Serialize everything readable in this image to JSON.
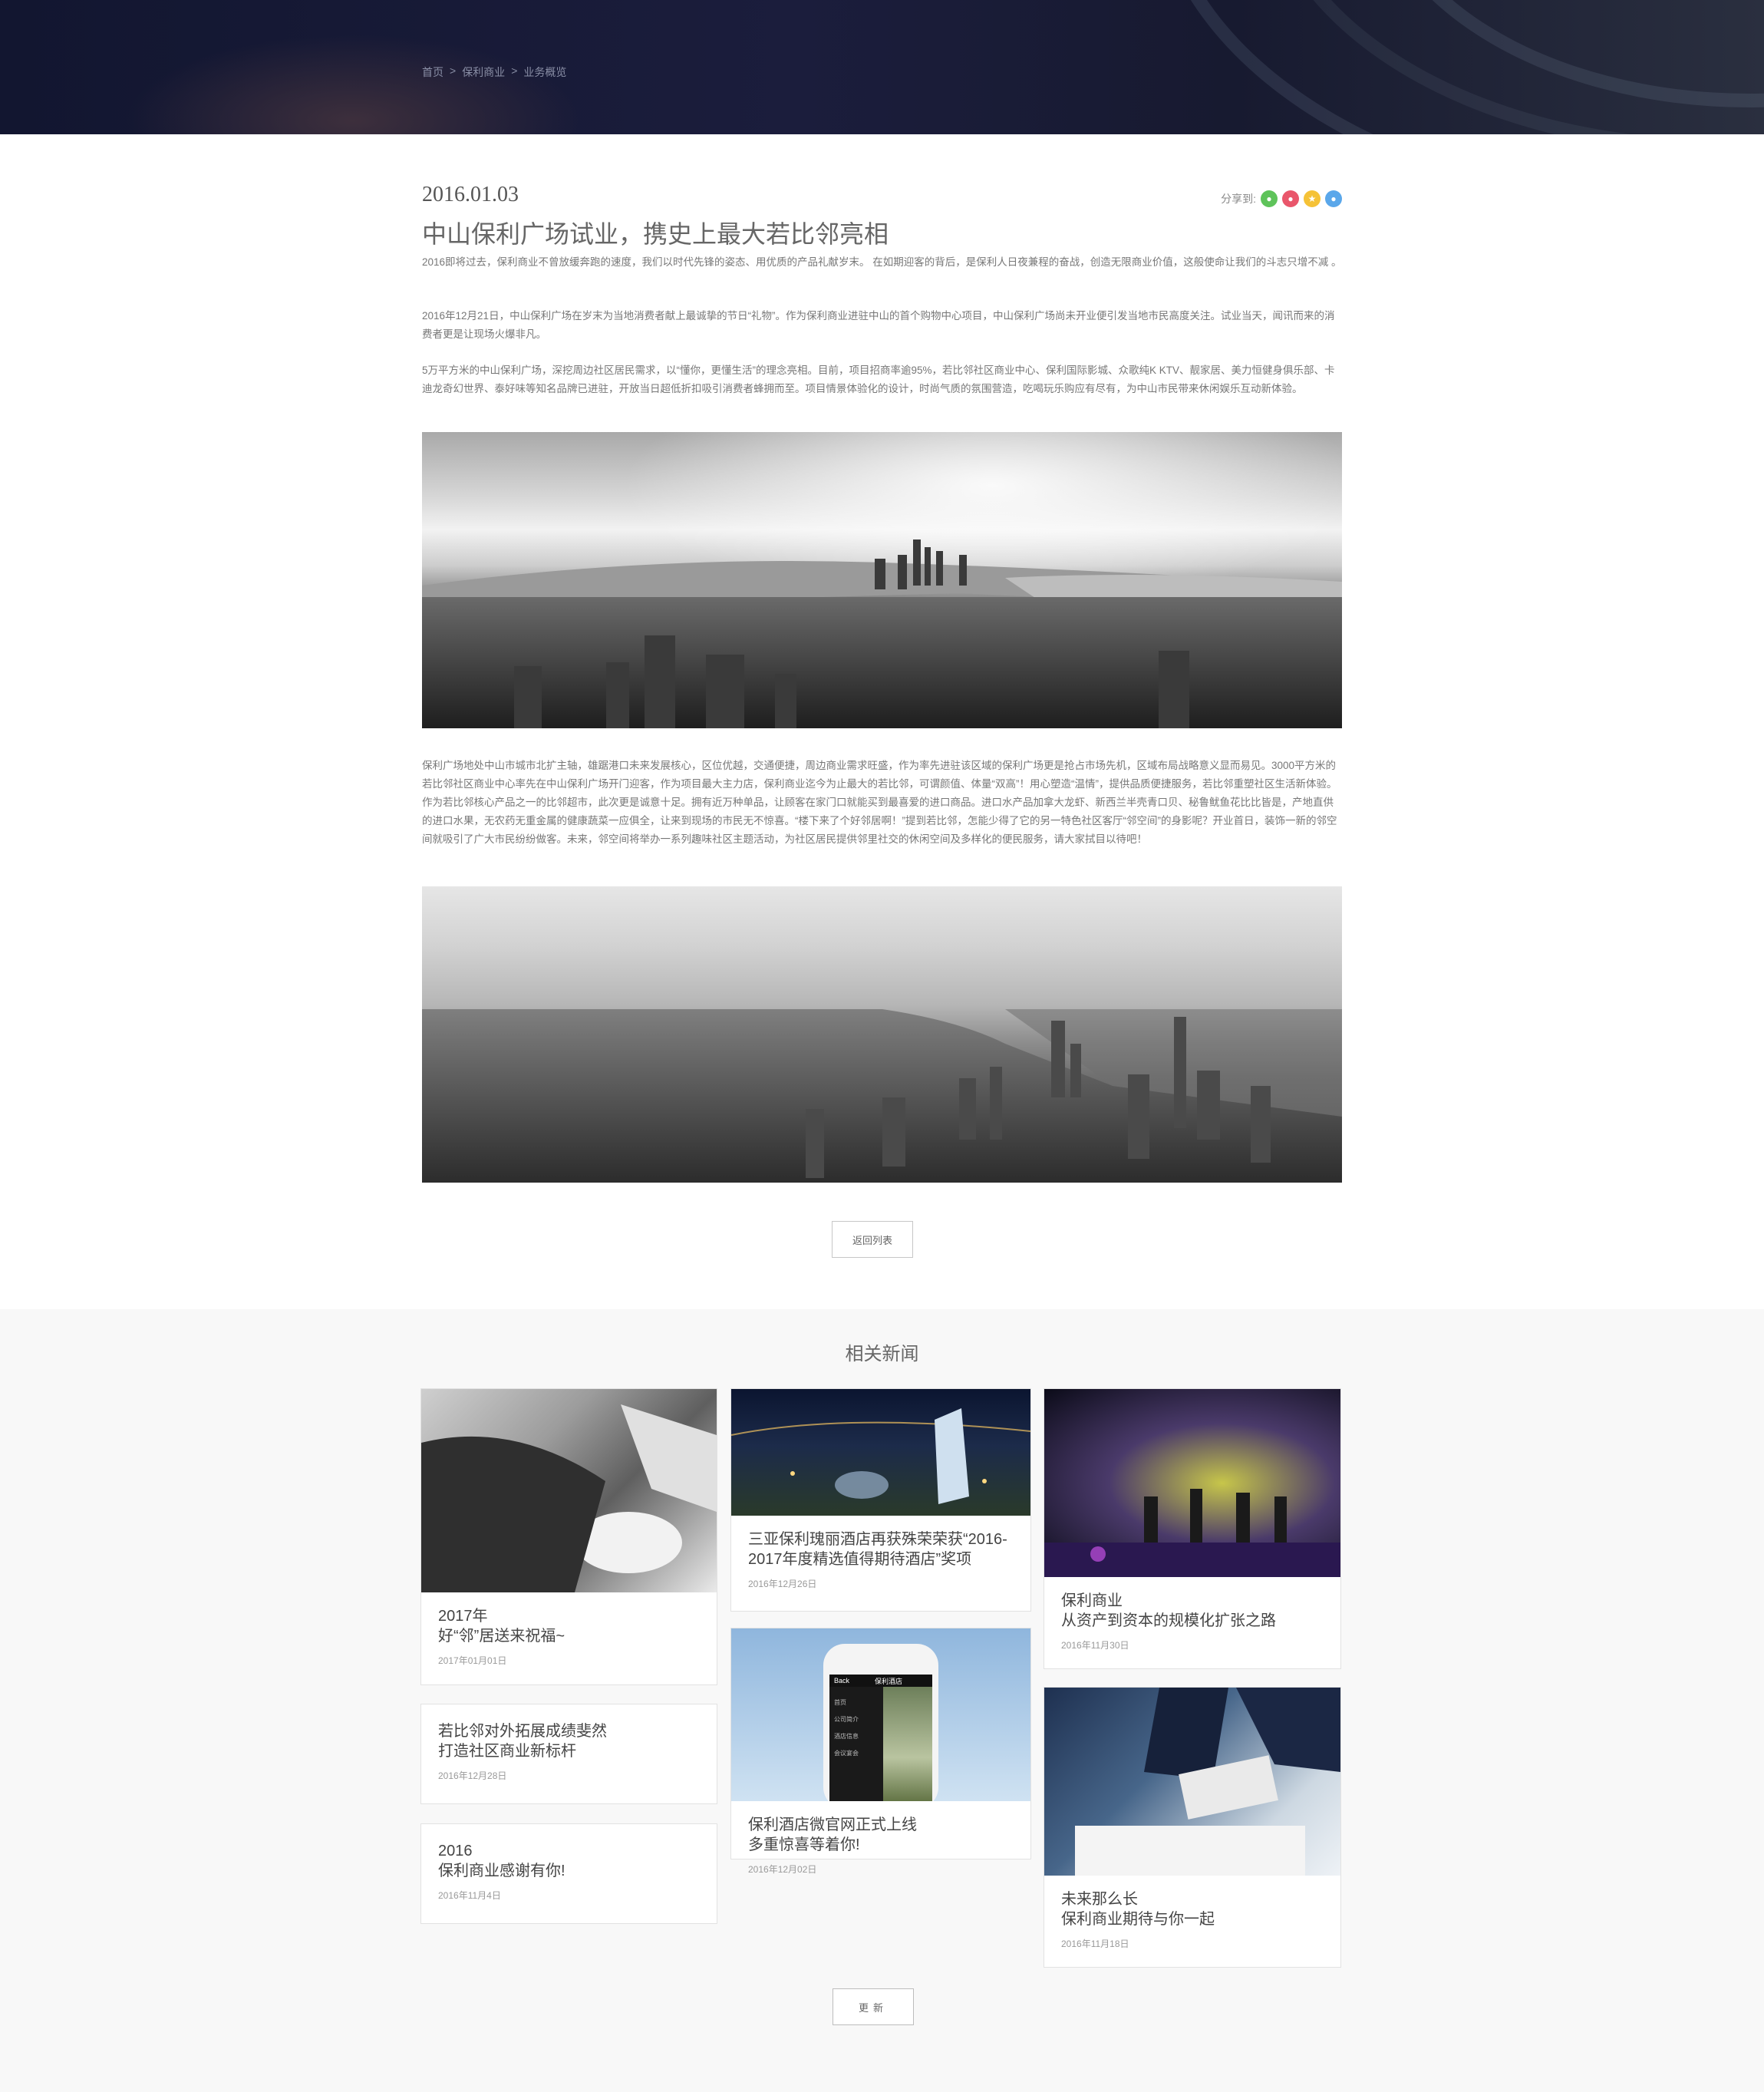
{
  "breadcrumb": {
    "home": "首页",
    "sep1": ">",
    "section": "保利商业",
    "sep2": ">",
    "current": "业务概览"
  },
  "article": {
    "date": "2016.01.03",
    "title": "中山保利广场试业，携史上最大若比邻亮相",
    "share_label": "分享到:",
    "share_icons": [
      "wechat-icon",
      "weibo-icon",
      "qzone-icon",
      "qq-icon"
    ],
    "share_colors": [
      "#5ec35a",
      "#e9566b",
      "#f5c237",
      "#5aa7ea"
    ],
    "paragraph_1": " 2016即将过去，保利商业不曾放缓奔跑的速度，我们以时代先锋的姿态、用优质的产品礼献岁末。 在如期迎客的背后，是保利人日夜兼程的奋战，创造无限商业价值，这般使命让我们的斗志只增不减 。",
    "paragraph_2": "2016年12月21日，中山保利广场在岁末为当地消费者献上最诚挚的节日“礼物”。作为保利商业进驻中山的首个购物中心项目，中山保利广场尚未开业便引发当地市民高度关注。试业当天，闻讯而来的消费者更是让现场火爆非凡。",
    "paragraph_3": "5万平方米的中山保利广场，深挖周边社区居民需求，以“懂你，更懂生活”的理念亮相。目前，项目招商率逾95%，若比邻社区商业中心、保利国际影城、众歌纯K KTV、靓家居、美力恒健身俱乐部、卡迪龙奇幻世界、泰好味等知名品牌已进驻，开放当日超低折扣吸引消费者蜂拥而至。项目情景体验化的设计，时尚气质的氛围营造，吃喝玩乐购应有尽有，为中山市民带来休闲娱乐互动新体验。",
    "paragraph_4": "保利广场地处中山市城市北扩主轴，雄踞港口未来发展核心，区位优越，交通便捷，周边商业需求旺盛，作为率先进驻该区域的保利广场更是抢占市场先机，区域布局战略意义显而易见。3000平方米的若比邻社区商业中心率先在中山保利广场开门迎客，作为项目最大主力店，保利商业迄今为止最大的若比邻，可谓颜值、体量“双高”！用心塑造“温情”，提供品质便捷服务，若比邻重塑社区生活新体验。作为若比邻核心产品之一的比邻超市，此次更是诚意十足。拥有近万种单品，让顾客在家门口就能买到最喜爱的进口商品。进口水产品加拿大龙虾、新西兰半壳青口贝、秘鲁鱿鱼花比比皆是，产地直供的进口水果，无农药无重金属的健康蔬菜一应俱全，让来到现场的市民无不惊喜。“楼下来了个好邻居啊！”提到若比邻，怎能少得了它的另一特色社区客厅“邻空间”的身影呢？开业首日，装饰一新的邻空间就吸引了广大市民纷纷做客。未来，邻空间将举办一系列趣味社区主题活动，为社区居民提供邻里社交的休闲空间及多样化的便民服务，请大家拭目以待吧！",
    "back_label": "返回列表"
  },
  "related": {
    "title": "相关新闻",
    "more_label": "更新",
    "cards": [
      {
        "title_1": "2017年",
        "title_2": "好“邻”居送来祝福~",
        "date": "2017年01月01日"
      },
      {
        "title_1": "若比邻对外拓展成绩斐然",
        "title_2": "打造社区商业新标杆",
        "date": "2016年12月28日"
      },
      {
        "title_1": "2016",
        "title_2": "保利商业感谢有你!",
        "date": "2016年11月4日"
      },
      {
        "title_1": "三亚保利瑰丽酒店再获殊荣荣获“2016-",
        "title_2": "2017年度精选值得期待酒店”奖项",
        "date": "2016年12月26日"
      },
      {
        "title_1": "保利酒店微官网正式上线",
        "title_2": "多重惊喜等着你!",
        "date": "2016年12月02日"
      },
      {
        "title_1": "保利商业",
        "title_2": "从资产到资本的规模化扩张之路",
        "date": "2016年11月30日"
      },
      {
        "title_1": "未来那么长",
        "title_2": "保利商业期待与你一起",
        "date": "2016年11月18日"
      }
    ],
    "phone": {
      "header": "保利酒店",
      "back": "Back",
      "menu": [
        "首页",
        "公司简介",
        "酒店信息",
        "会议宴会"
      ]
    }
  }
}
